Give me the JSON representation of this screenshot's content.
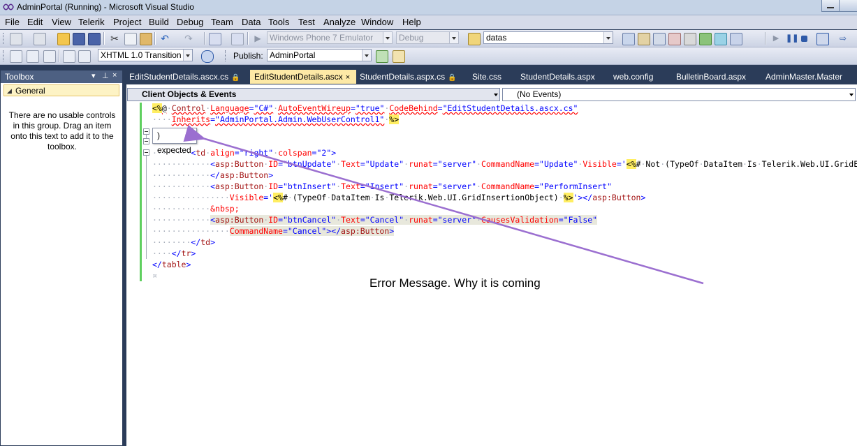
{
  "window": {
    "title": "AdminPortal (Running) - Microsoft Visual Studio"
  },
  "menu": [
    "File",
    "Edit",
    "View",
    "Telerik",
    "Project",
    "Build",
    "Debug",
    "Team",
    "Data",
    "Tools",
    "Test",
    "Analyze",
    "Window",
    "Help"
  ],
  "toolbar1": {
    "emulator_value": "Windows Phone 7 Emulator",
    "config_value": "Debug",
    "find_value": "datas"
  },
  "toolbar2": {
    "schema_value": "XHTML 1.0 Transition",
    "publish_label": "Publish:",
    "publish_value": "AdminPortal"
  },
  "toolbox": {
    "title": "Toolbox",
    "pin_glyph": "▾ ⊥ ×",
    "group": "General",
    "empty_message": "There are no usable controls in this group. Drag an item onto this text to add it to the toolbox."
  },
  "tabs": [
    {
      "label": "EditStudentDetails.ascx.cs",
      "locked": true
    },
    {
      "label": "EditStudentDetails.ascx",
      "locked": false,
      "active": true
    },
    {
      "label": "StudentDetails.aspx.cs",
      "locked": true
    },
    {
      "label": "Site.css"
    },
    {
      "label": "StudentDetails.aspx"
    },
    {
      "label": "web.config"
    },
    {
      "label": "BulletinBoard.aspx"
    },
    {
      "label": "AdminMaster.Master"
    }
  ],
  "navbar": {
    "objects_combo": "Client Objects & Events",
    "events_combo": "(No Events)"
  },
  "tooltip": {
    "text": ") expected"
  },
  "annotation": {
    "text": "Error Message. Why it is coming"
  },
  "colors": {
    "ide_background": "#2b3c59",
    "active_tab": "#fde9a6",
    "server_tag_highlight": "#ffee62",
    "arrow": "#9b6fd0",
    "change_bar": "#5fd05f"
  }
}
